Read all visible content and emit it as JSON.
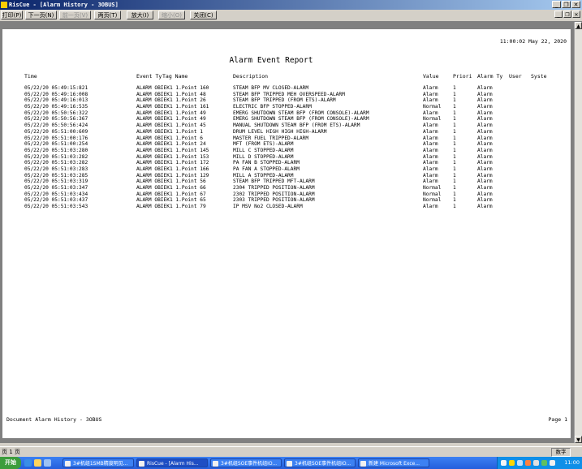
{
  "window": {
    "title": "RisCue - [Alarm History - 3OBUS]"
  },
  "toolbar": {
    "buttons": [
      {
        "label": "打印(P)",
        "enabled": true
      },
      {
        "label": "下一页(N)",
        "enabled": true
      },
      {
        "label": "前一页(V)",
        "enabled": false
      },
      {
        "label": "两页(T)",
        "enabled": true
      },
      {
        "label": "放大(I)",
        "enabled": true
      },
      {
        "label": "缩小(O)",
        "enabled": false
      },
      {
        "label": "关闭(C)",
        "enabled": true
      }
    ]
  },
  "report": {
    "timestamp": "11:00:02 May 22, 2020",
    "title": "Alarm Event Report",
    "columns": [
      "Time",
      "Event Ty",
      "Tag Name",
      "Description",
      "Value",
      "Priori",
      "Alarm Ty",
      "User",
      "Syste"
    ],
    "rows": [
      {
        "time": "05/22/20 05:49:15:821",
        "tag": "ALARM OBIEK1 1.Point 160",
        "desc": "STEAM  BFP MV CLOSED-ALARM",
        "value": "Alarm",
        "prio": "1",
        "atype": "Alarm"
      },
      {
        "time": "05/22/20 05:49:16:008",
        "tag": "ALARM OBIEK1 1.Point 48",
        "desc": "STEAM BFP TRIPPED MEH OVERSPEED-ALARM",
        "value": "Alarm",
        "prio": "1",
        "atype": "Alarm"
      },
      {
        "time": "05/22/20 05:49:16:013",
        "tag": "ALARM OBIEK1 1.Point 26",
        "desc": "STEAM BFP TRIPPED (FROM ETS)-ALARM",
        "value": "Alarm",
        "prio": "1",
        "atype": "Alarm"
      },
      {
        "time": "05/22/20 05:49:16:535",
        "tag": "ALARM OBIEK1 1.Point 161",
        "desc": "ELECTRIC BFP STOPPED-ALARM",
        "value": "Normal",
        "prio": "1",
        "atype": "Alarm"
      },
      {
        "time": "05/22/20 05:50:56:322",
        "tag": "ALARM OBIEK1 1.Point 49",
        "desc": "EMERG SHUTDOWN STEAM BFP  (FROM CONSOLE)-ALARM",
        "value": "Alarm",
        "prio": "1",
        "atype": "Alarm"
      },
      {
        "time": "05/22/20 05:50:56:367",
        "tag": "ALARM OBIEK1 1.Point 49",
        "desc": "EMERG SHUTDOWN STEAM BFP  (FROM CONSOLE)-ALARM",
        "value": "Normal",
        "prio": "1",
        "atype": "Alarm"
      },
      {
        "time": "05/22/20 05:50:56:424",
        "tag": "ALARM OBIEK1 1.Point 45",
        "desc": "MANUAL SHUTDOWN STEAM BFP  (FROM ETS)-ALARM",
        "value": "Alarm",
        "prio": "1",
        "atype": "Alarm"
      },
      {
        "time": "05/22/20 05:51:00:609",
        "tag": "ALARM OBIEK1 1.Point 1",
        "desc": "DRUM LEVEL HIGH HIGH HIGH-ALARM",
        "value": "Alarm",
        "prio": "1",
        "atype": "Alarm"
      },
      {
        "time": "05/22/20 05:51:00:176",
        "tag": "ALARM OBIEK1 1.Point 6",
        "desc": "MASTER FUEL TRIPPED-ALARM",
        "value": "Alarm",
        "prio": "1",
        "atype": "Alarm"
      },
      {
        "time": "05/22/20 05:51:00:254",
        "tag": "ALARM OBIEK1 1.Point 24",
        "desc": "MFT (FROM ETS)-ALARM",
        "value": "Alarm",
        "prio": "1",
        "atype": "Alarm"
      },
      {
        "time": "05/22/20 05:51:03:280",
        "tag": "ALARM OBIEK1 1.Point 145",
        "desc": "MILL C STOPPED-ALARM",
        "value": "Alarm",
        "prio": "1",
        "atype": "Alarm"
      },
      {
        "time": "05/22/20 05:51:03:282",
        "tag": "ALARM OBIEK1 1.Point 153",
        "desc": "MILL D STOPPED-ALARM",
        "value": "Alarm",
        "prio": "1",
        "atype": "Alarm"
      },
      {
        "time": "05/22/20 05:51:03:282",
        "tag": "ALARM OBIEK1 1.Point 172",
        "desc": "PA FAN B STOPPED-ALARM",
        "value": "Alarm",
        "prio": "1",
        "atype": "Alarm"
      },
      {
        "time": "05/22/20 05:51:03:283",
        "tag": "ALARM OBIEK1 1.Point 166",
        "desc": "PA FAN A STOPPED-ALARM",
        "value": "Alarm",
        "prio": "1",
        "atype": "Alarm"
      },
      {
        "time": "05/22/20 05:51:03:285",
        "tag": "ALARM OBIEK1 1.Point 129",
        "desc": "MILL A STOPPED-ALARM",
        "value": "Alarm",
        "prio": "1",
        "atype": "Alarm"
      },
      {
        "time": "05/22/20 05:51:03:319",
        "tag": "ALARM OBIEK1 1.Point 56",
        "desc": "STEAM BFP TRIPPED MFT-ALARM",
        "value": "Alarm",
        "prio": "1",
        "atype": "Alarm"
      },
      {
        "time": "05/22/20 05:51:03:347",
        "tag": "ALARM OBIEK1 1.Point 66",
        "desc": "2304 TRIPPED POSITION-ALARM",
        "value": "Normal",
        "prio": "1",
        "atype": "Alarm"
      },
      {
        "time": "05/22/20 05:51:03:434",
        "tag": "ALARM OBIEK1 1.Point 67",
        "desc": "2302 TRIPPED POSITION-ALARM",
        "value": "Normal",
        "prio": "1",
        "atype": "Alarm"
      },
      {
        "time": "05/22/20 05:51:03:437",
        "tag": "ALARM OBIEK1 1.Point 65",
        "desc": "2303 TRIPPED POSITION-ALARM",
        "value": "Normal",
        "prio": "1",
        "atype": "Alarm"
      },
      {
        "time": "05/22/20 05:51:03:543",
        "tag": "ALARM OBIEK1 1.Point 79",
        "desc": "IP MSV No2 CLOSED-ALARM",
        "value": "Alarm",
        "prio": "1",
        "atype": "Alarm"
      }
    ],
    "footer_left": "Document Alarm History - 3OBUS",
    "footer_right": "Page 1"
  },
  "statusbar": {
    "page": "页 1 页",
    "indicator": "数字"
  },
  "taskbar": {
    "start": "开始",
    "tasks": [
      {
        "label": "3#机组1SMB精度明见...",
        "active": false
      },
      {
        "label": "RisCue - [Alarm His...",
        "active": true
      },
      {
        "label": "3#机组SOE事件机组IO...",
        "active": false
      },
      {
        "label": "3#机组SOE事件机组IO...",
        "active": false
      },
      {
        "label": "新建 Microsoft Exce...",
        "active": false
      }
    ],
    "clock": "11:00"
  },
  "colors": {
    "titlebar": "#0a246a",
    "taskbar": "#245edc",
    "preview_bg": "#808080"
  }
}
